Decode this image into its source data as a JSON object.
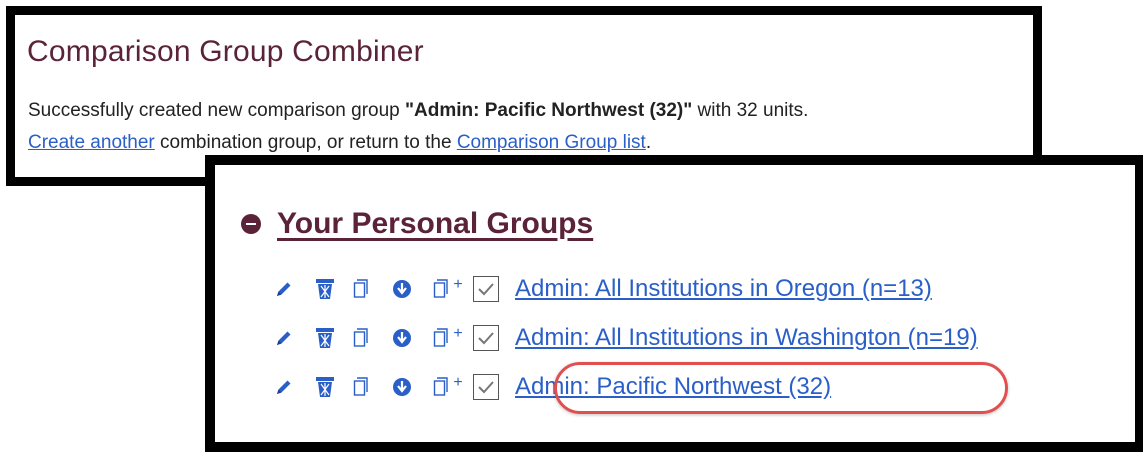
{
  "colors": {
    "brand": "#5b2339",
    "link": "#2a5fc8",
    "highlight": "#e05050"
  },
  "combiner": {
    "title": "Comparison Group Combiner",
    "message_prefix": "Successfully created new comparison group ",
    "group_name": "\"Admin: Pacific Northwest (32)\"",
    "message_suffix": " with 32 units.",
    "create_another_link": "Create another",
    "middle_text": " combination group, or return to the ",
    "comparison_list_link": "Comparison Group list",
    "period": "."
  },
  "personal_groups": {
    "title": "Your Personal Groups",
    "row_icons": [
      "pencil-icon",
      "trash-icon",
      "copy-icon",
      "download-icon",
      "copy-add-icon",
      "checkbox"
    ],
    "copy_add_plus": "+",
    "groups": [
      {
        "label": "Admin: All Institutions in Oregon (n=13)",
        "checked": true
      },
      {
        "label": "Admin: All Institutions in Washington (n=19)",
        "checked": true
      },
      {
        "label": "Admin: Pacific Northwest (32)",
        "checked": true,
        "highlighted": true
      }
    ]
  }
}
